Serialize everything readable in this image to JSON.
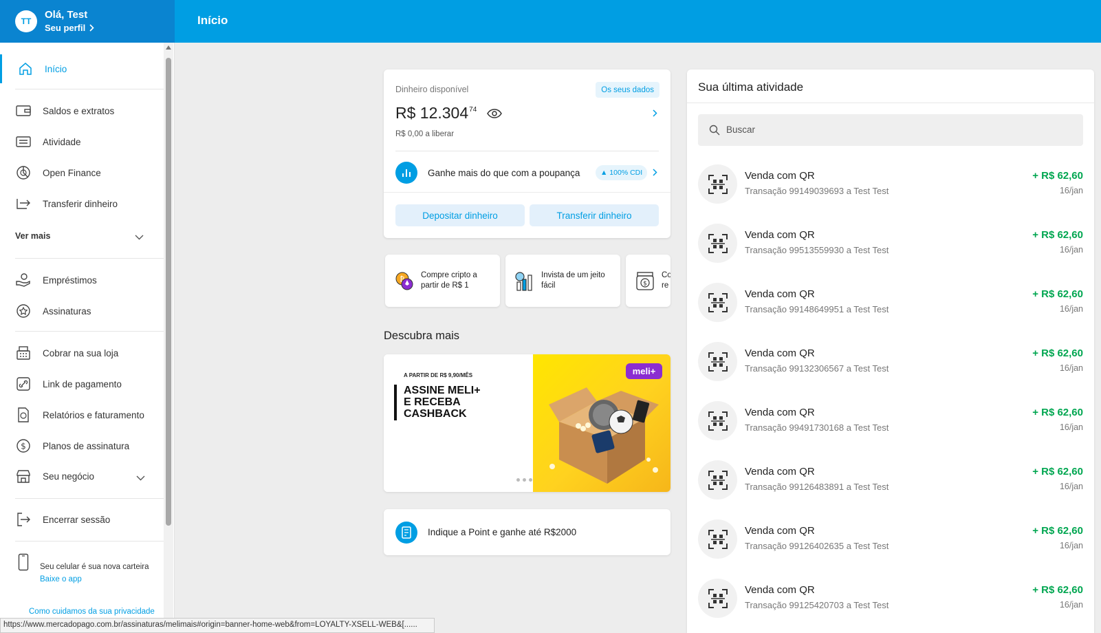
{
  "header": {
    "avatar_initials": "TT",
    "greeting": "Olá, Test",
    "profile_link": "Seu perfil",
    "page_title": "Início",
    "brand_color": "#009ee3"
  },
  "sidebar": {
    "items": [
      {
        "label": "Início",
        "icon": "home-icon"
      },
      {
        "label": "Saldos e extratos",
        "icon": "wallet-icon"
      },
      {
        "label": "Atividade",
        "icon": "list-icon"
      },
      {
        "label": "Open Finance",
        "icon": "open-finance-icon"
      },
      {
        "label": "Transferir dinheiro",
        "icon": "transfer-icon"
      },
      {
        "label": "Empréstimos",
        "icon": "loan-hand-icon"
      },
      {
        "label": "Assinaturas",
        "icon": "star-badge-icon"
      },
      {
        "label": "Cobrar na sua loja",
        "icon": "register-icon"
      },
      {
        "label": "Link de pagamento",
        "icon": "link-icon"
      },
      {
        "label": "Relatórios e faturamento",
        "icon": "report-icon"
      },
      {
        "label": "Planos de assinatura",
        "icon": "dollar-circle-icon"
      },
      {
        "label": "Seu negócio",
        "icon": "store-icon"
      },
      {
        "label": "Encerrar sessão",
        "icon": "logout-icon"
      }
    ],
    "ver_mais": "Ver mais",
    "phone_text": "Seu celular é sua nova carteira",
    "phone_link": "Baixe o app",
    "privacy_link": "Como cuidamos da sua privacidade"
  },
  "status_url": "https://www.mercadopago.com.br/assinaturas/melimais#origin=banner-home-web&from=LOYALTY-XSELL-WEB&[......",
  "balance": {
    "label": "Dinheiro disponível",
    "data_pill": "Os seus dados",
    "amount": "R$ 12.304",
    "cents": "74",
    "pending": "R$ 0,00 a liberar",
    "savings_text": "Ganhe mais do que com a poupança",
    "cdi": "▲ 100% CDI",
    "deposit_button": "Depositar dinheiro",
    "transfer_button": "Transferir dinheiro"
  },
  "quick_actions": [
    {
      "label": "Compre cripto a partir de R$ 1",
      "icon": "crypto-icon"
    },
    {
      "label": "Invista de um jeito fácil",
      "icon": "invest-icon"
    },
    {
      "label": "Co re",
      "icon": "money-jar-icon"
    }
  ],
  "discover": {
    "title": "Descubra mais",
    "banner_small": "A PARTIR DE R$ 9,90/MÊS",
    "banner_line1": "ASSINE MELI+",
    "banner_line2": "E RECEBA",
    "banner_line3": "CASHBACK",
    "banner_badge": "meli+"
  },
  "point_card": {
    "text": "Indique a Point e ganhe até R$2000"
  },
  "activity": {
    "title": "Sua última atividade",
    "search_placeholder": "Buscar",
    "positive_color": "#00a650",
    "transactions": [
      {
        "title": "Venda com QR",
        "subtitle": "Transação 99149039693 a Test Test",
        "amount": "+ R$ 62,60",
        "date": "16/jan"
      },
      {
        "title": "Venda com QR",
        "subtitle": "Transação 99513559930 a Test Test",
        "amount": "+ R$ 62,60",
        "date": "16/jan"
      },
      {
        "title": "Venda com QR",
        "subtitle": "Transação 99148649951 a Test Test",
        "amount": "+ R$ 62,60",
        "date": "16/jan"
      },
      {
        "title": "Venda com QR",
        "subtitle": "Transação 99132306567 a Test Test",
        "amount": "+ R$ 62,60",
        "date": "16/jan"
      },
      {
        "title": "Venda com QR",
        "subtitle": "Transação 99491730168 a Test Test",
        "amount": "+ R$ 62,60",
        "date": "16/jan"
      },
      {
        "title": "Venda com QR",
        "subtitle": "Transação 99126483891 a Test Test",
        "amount": "+ R$ 62,60",
        "date": "16/jan"
      },
      {
        "title": "Venda com QR",
        "subtitle": "Transação 99126402635 a Test Test",
        "amount": "+ R$ 62,60",
        "date": "16/jan"
      },
      {
        "title": "Venda com QR",
        "subtitle": "Transação 99125420703 a Test Test",
        "amount": "+ R$ 62,60",
        "date": "16/jan"
      }
    ]
  }
}
